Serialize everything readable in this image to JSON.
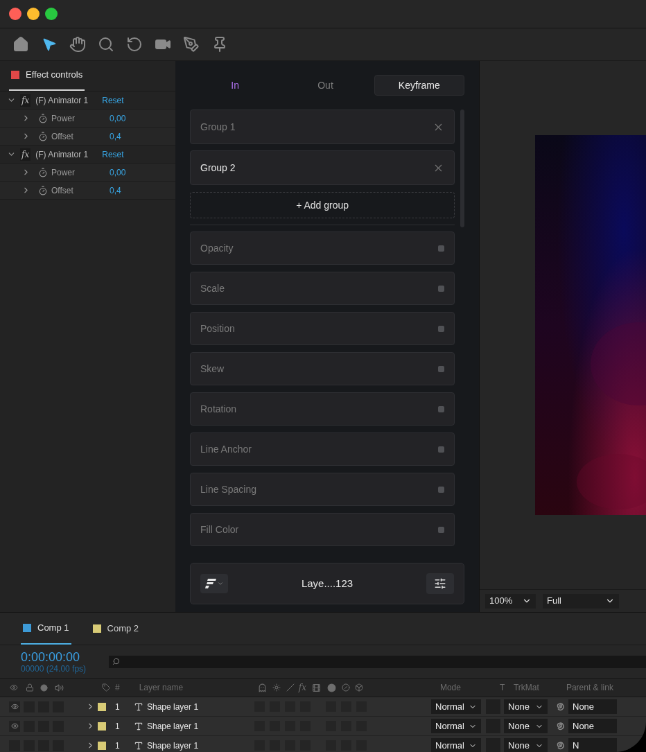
{
  "window": {
    "controls": [
      {
        "color": "#ff5f57"
      },
      {
        "color": "#febc2e"
      },
      {
        "color": "#28c840"
      }
    ]
  },
  "toolbar": {
    "tools": [
      {
        "selected": false
      },
      {
        "selected": true
      },
      {
        "selected": false
      },
      {
        "selected": false
      },
      {
        "selected": false
      },
      {
        "selected": false
      },
      {
        "selected": false
      },
      {
        "selected": false
      }
    ]
  },
  "effect_panel": {
    "tab": {
      "label": "Effect controls",
      "color": "#e04848",
      "selected": true
    },
    "effects": [
      {
        "fx": "fx",
        "name": "(F) Animator 1",
        "action": "Reset",
        "expanded": true,
        "children": [
          {
            "name": "Power",
            "value": "0,00",
            "expanded": false
          },
          {
            "name": "Offset",
            "value": "0,4",
            "expanded": false
          }
        ]
      },
      {
        "fx": "fx",
        "name": "(F) Animator 1",
        "action": "Reset",
        "expanded": true,
        "children": [
          {
            "name": "Power",
            "value": "0,00",
            "expanded": false
          },
          {
            "name": "Offset",
            "value": "0,4",
            "expanded": false
          }
        ]
      }
    ]
  },
  "animator": {
    "tabs": [
      {
        "label": "In",
        "selected": true
      },
      {
        "label": "Out",
        "selected": false
      }
    ],
    "keyframe_button": "Keyframe",
    "groups": [
      {
        "label": "Group 1",
        "selected": false
      },
      {
        "label": "Group 2",
        "selected": true
      }
    ],
    "add_group": "+ Add group",
    "properties": [
      {
        "label": "Opacity"
      },
      {
        "label": "Scale"
      },
      {
        "label": "Position"
      },
      {
        "label": "Skew"
      },
      {
        "label": "Rotation"
      },
      {
        "label": "Line Anchor"
      },
      {
        "label": "Line Spacing"
      },
      {
        "label": "Fill Color"
      }
    ],
    "footer": {
      "layer": "Laye....123"
    }
  },
  "viewer": {
    "zoom": "100%",
    "resolution": "Full"
  },
  "timeline": {
    "comps": [
      {
        "label": "Comp 1",
        "color": "#3d9ad6",
        "selected": true
      },
      {
        "label": "Comp 2",
        "color": "#d8cb76",
        "selected": false
      }
    ],
    "timecode": "0:00:00:00",
    "frames": "00000 (24.00 fps)",
    "columns": {
      "number": "#",
      "layer_name": "Layer name",
      "fx": "fx",
      "mode": "Mode",
      "t": "T",
      "trkmat": "TrkMat",
      "parent": "Parent & link"
    },
    "layers": [
      {
        "visible": true,
        "color": "#d8cb76",
        "number": "1",
        "name": "Shape layer 1",
        "mode": "Normal",
        "trkmat": "None",
        "parent": "None"
      },
      {
        "visible": true,
        "color": "#d8cb76",
        "number": "1",
        "name": "Shape layer 1",
        "mode": "Normal",
        "trkmat": "None",
        "parent": "None"
      },
      {
        "visible": false,
        "color": "#d8cb76",
        "number": "1",
        "name": "Shape layer 1",
        "mode": "Normal",
        "trkmat": "None",
        "parent": "N"
      }
    ]
  }
}
